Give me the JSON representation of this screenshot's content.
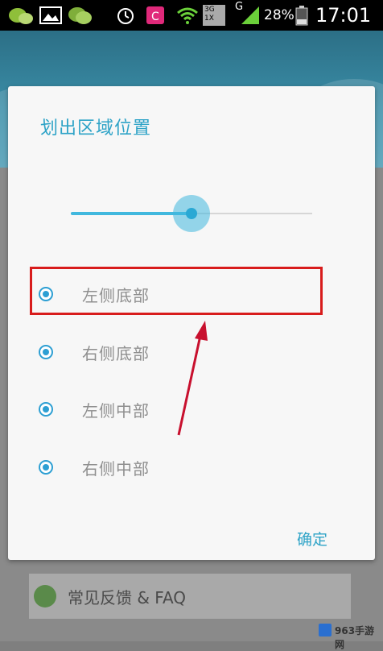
{
  "status_bar": {
    "g_badge": "G",
    "net_badge": "3G 1X",
    "battery_percent": "28%",
    "time": "17:01",
    "icons": [
      "wechat-icon",
      "gallery-icon",
      "message-icon",
      "alarm-icon",
      "app-icon",
      "wifi-icon",
      "signal-icon",
      "battery-icon"
    ]
  },
  "background": {
    "list_item_label": "常见反馈 & FAQ"
  },
  "dialog": {
    "title": "划出区域位置",
    "slider_level": 0.5,
    "options": [
      {
        "label": "左侧底部"
      },
      {
        "label": "右侧底部"
      },
      {
        "label": "左侧中部"
      },
      {
        "label": "右侧中部"
      }
    ],
    "confirm_label": "确定"
  },
  "colors": {
    "accent": "#2ea3c7",
    "highlight": "#d81c1c"
  },
  "watermark": {
    "text": "963手游网"
  }
}
